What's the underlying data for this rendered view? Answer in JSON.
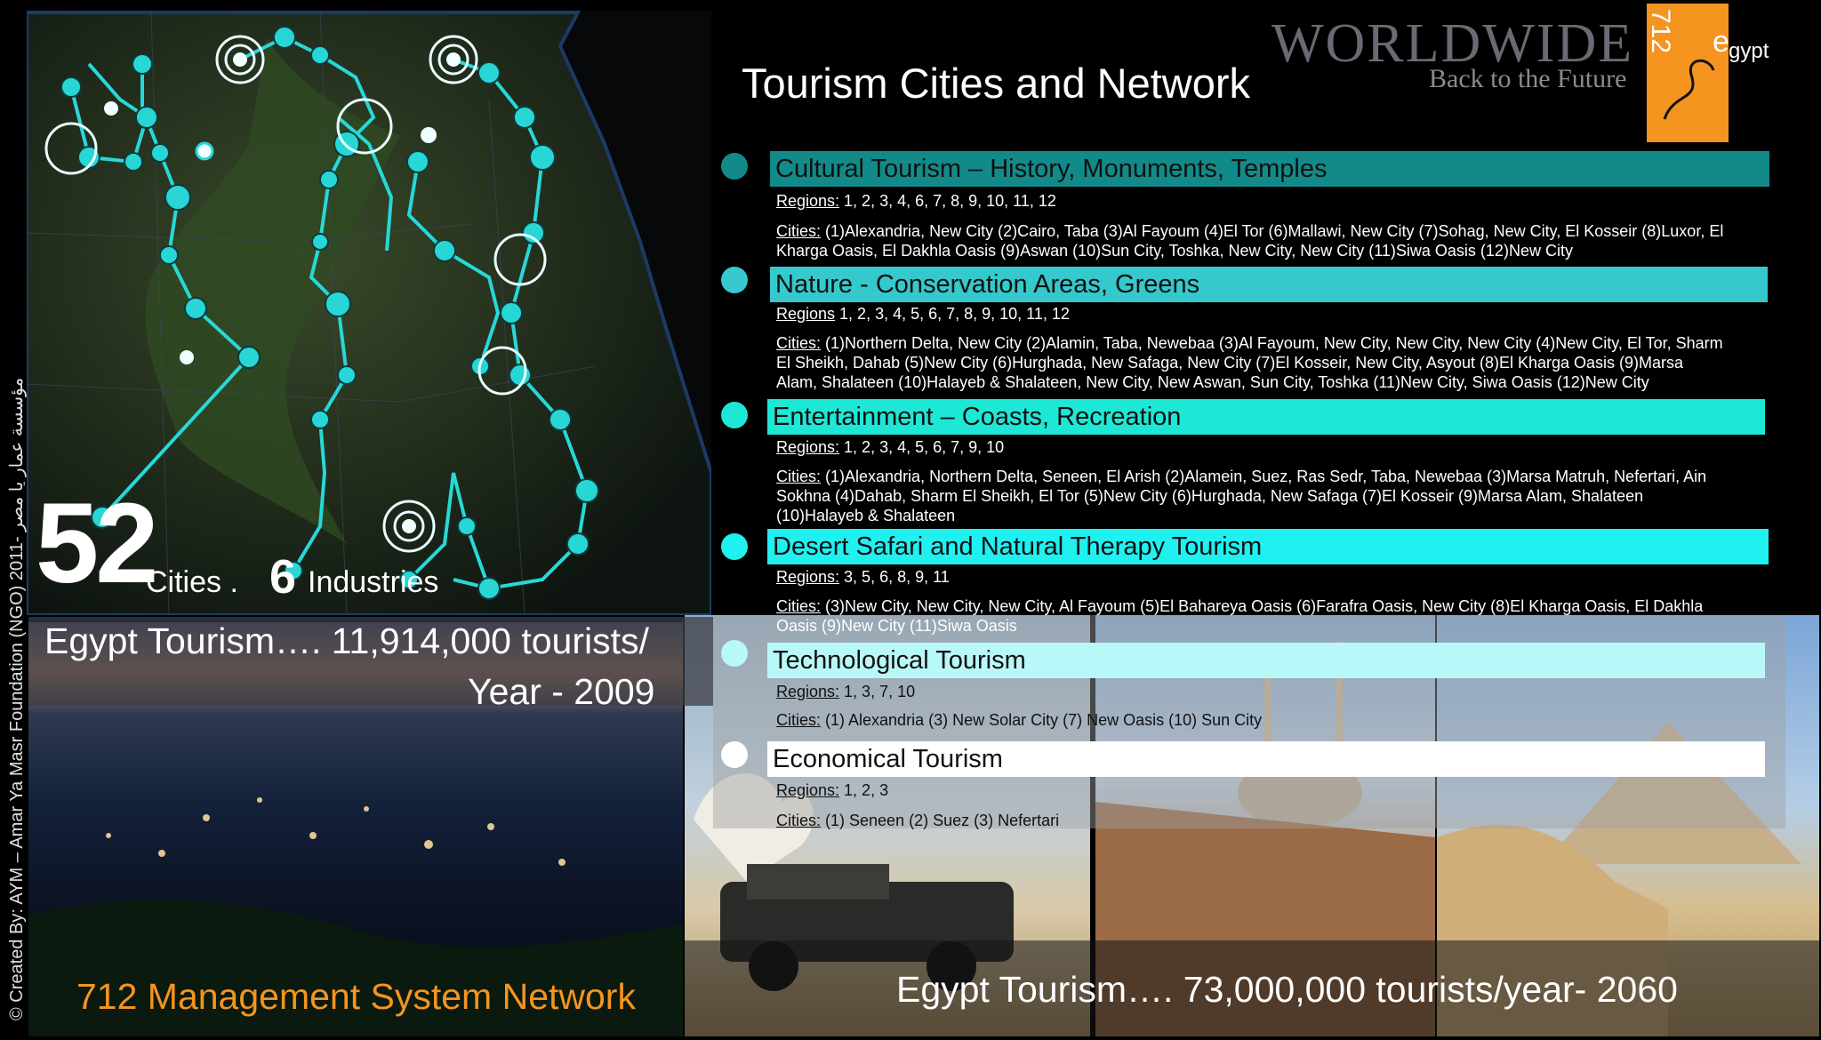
{
  "map": {
    "big_number": "52",
    "cities_label": "Cities .",
    "industries_number": "6",
    "industries_label": "Industries"
  },
  "credit": "© Created By: AYM – Amar Ya Masr Foundation (NGO) مؤسسة عمار يا مصر -2011",
  "tourism_2009": {
    "line1": "Egypt Tourism…. 11,914,000 tourists/",
    "line2": "Year - 2009"
  },
  "footer": {
    "left": "712 Management System Network",
    "right": "Egypt Tourism…. 73,000,000 tourists/year- 2060"
  },
  "logo": {
    "word": "WORLDWIDE",
    "sub": "Back to the Future",
    "num": "712",
    "e": "e",
    "gypt": "gypt"
  },
  "title": "Tourism Cities and Network",
  "categories": [
    {
      "title": "Cultural Tourism – History, Monuments, Temples",
      "color": "#138a8a",
      "bullet": "#138a8a",
      "regions_label": "Regions:",
      "regions": " 1, 2, 3, 4, 6, 7, 8, 9, 10, 11, 12",
      "cities_label": "Cities:",
      "cities_lines": [
        " (1)Alexandria, New City  (2)Cairo, Taba  (3)Al Fayoum  (4)El Tor  (6)Mallawi, New City  (7)Sohag, New City, El Kosseir  (8)Luxor, El",
        "Kharga Oasis, El Dakhla Oasis  (9)Aswan  (10)Sun City, Toshka, New City, New City  (11)Siwa Oasis  (12)New City"
      ]
    },
    {
      "title": "Nature - Conservation Areas, Greens",
      "color": "#35c8cc",
      "bullet": "#35c8cc",
      "regions_label": "Regions",
      "regions": " 1, 2, 3, 4, 5, 6, 7, 8, 9, 10, 11, 12",
      "cities_label": "Cities:",
      "cities_lines": [
        " (1)Northern Delta, New City  (2)Alamin, Taba, Newebaa  (3)Al Fayoum, New City, New City, New City  (4)New City, El Tor, Sharm",
        "El Sheikh, Dahab  (5)New City  (6)Hurghada, New Safaga, New City  (7)El Kosseir, New City, Asyout  (8)El Kharga Oasis  (9)Marsa",
        "Alam, Shalateen  (10)Halayeb & Shalateen, New City, New Aswan, Sun City, Toshka  (11)New City, Siwa Oasis  (12)New City"
      ]
    },
    {
      "title": "Entertainment – Coasts, Recreation",
      "color": "#1de8d6",
      "bullet": "#1de8d6",
      "regions_label": "Regions:",
      "regions": " 1, 2, 3, 4, 5, 6, 7, 9, 10",
      "cities_label": "Cities:",
      "cities_lines": [
        " (1)Alexandria, Northern Delta, Seneen, El Arish  (2)Alamein, Suez, Ras Sedr, Taba, Newebaa  (3)Marsa Matruh, Nefertari, Ain",
        "Sokhna  (4)Dahab, Sharm El Sheikh, El Tor  (5)New City  (6)Hurghada, New Safaga  (7)El Kosseir  (9)Marsa Alam, Shalateen",
        "(10)Halayeb & Shalateen"
      ]
    },
    {
      "title": "Desert Safari and Natural Therapy Tourism",
      "color": "#1ff0f0",
      "bullet": "#1ff0f0",
      "regions_label": "Regions:",
      "regions": " 3, 5, 6, 8, 9, 11",
      "cities_label": "Cities:",
      "cities_lines": [
        " (3)New City, New City, New City, Al Fayoum  (5)El Bahareya Oasis  (6)Farafra Oasis, New City  (8)El Kharga Oasis, El Dakhla",
        "Oasis  (9)New City  (11)Siwa Oasis"
      ]
    },
    {
      "title": "Technological Tourism",
      "color": "#b8f8f8",
      "bullet": "#b8f8f8",
      "regions_label": "Regions:",
      "regions": " 1, 3, 7, 10",
      "cities_label": "Cities:",
      "cities_lines": [
        " (1) Alexandria  (3) New Solar City  (7) New Oasis  (10) Sun City"
      ]
    },
    {
      "title": "Economical Tourism",
      "color": "#ffffff",
      "bullet": "#ffffff",
      "regions_label": "Regions:",
      "regions": " 1, 2, 3",
      "cities_label": "Cities:",
      "cities_lines": [
        " (1) Seneen  (2) Suez  (3) Nefertari"
      ]
    }
  ]
}
